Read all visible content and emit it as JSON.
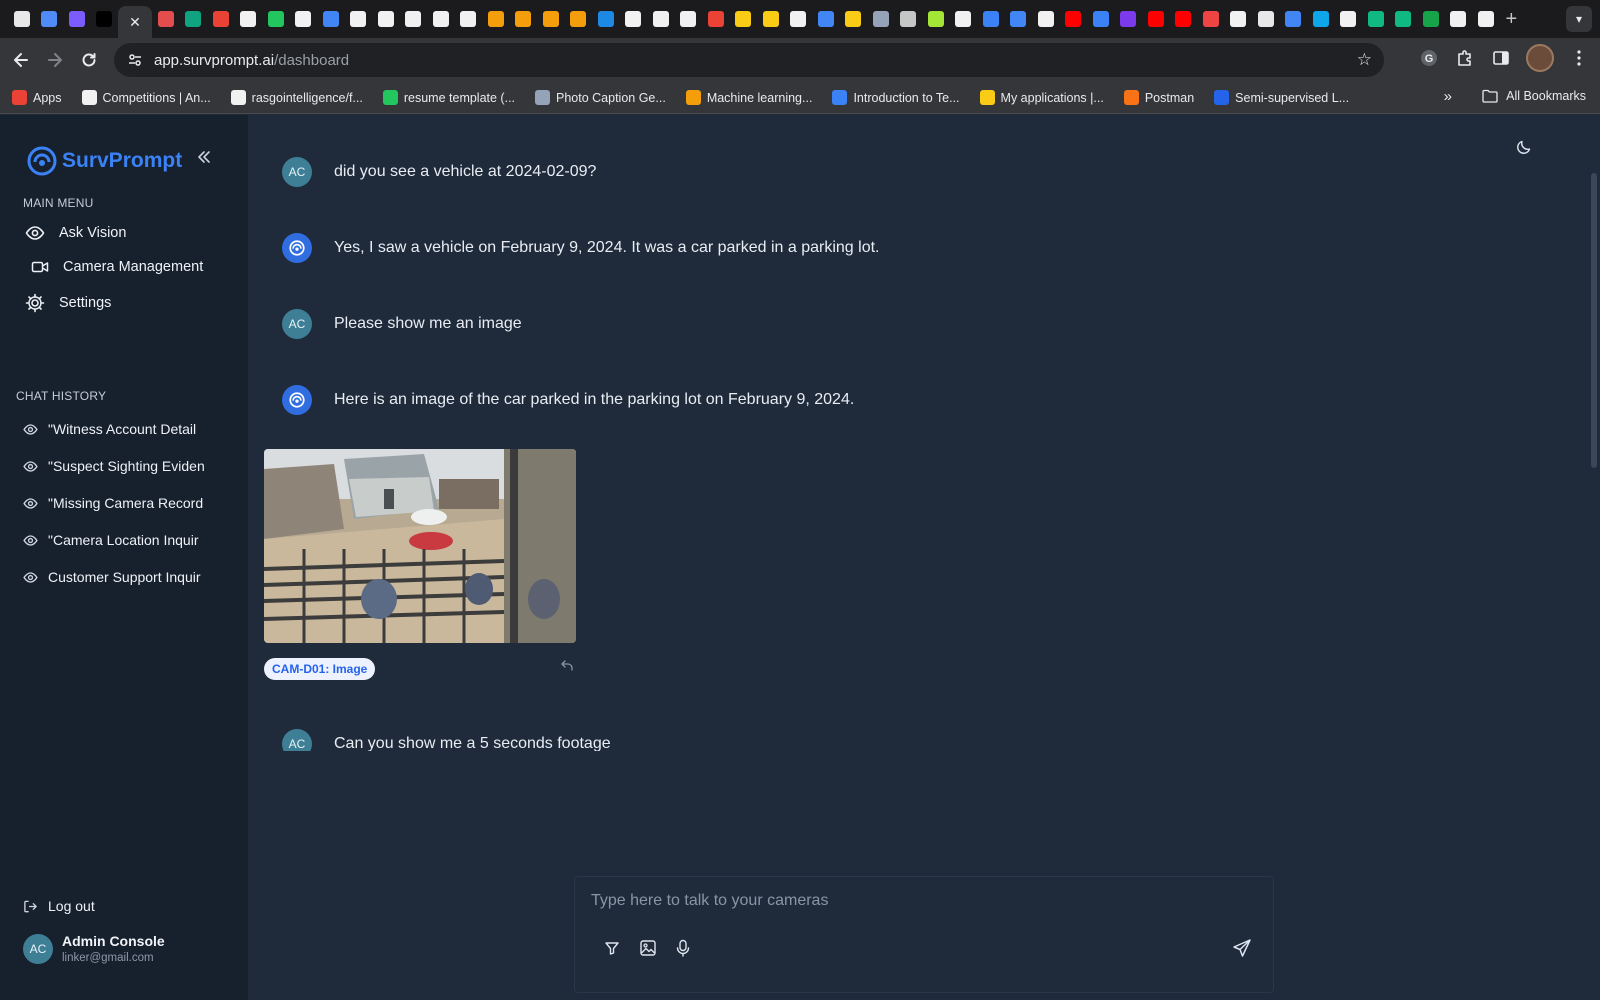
{
  "browser": {
    "active_tab_close": "✕",
    "url_domain": "app.survprompt.ai",
    "url_path": "/dashboard",
    "tab_favicon_colors": [
      "#e8e8e8",
      "#4f8cf7",
      "#7c5cff",
      "#000000",
      "#e34d4d",
      "#10a37f",
      "#ea4335",
      "#f1f1f1",
      "#22c55e",
      "#f1f1f1",
      "#4285f4",
      "#f1f1f1",
      "#f1f1f1",
      "#f1f1f1",
      "#f1f1f1",
      "#f1f1f1",
      "#f59e0b",
      "#f59e0b",
      "#f59e0b",
      "#f59e0b",
      "#1e88e5",
      "#f1f1f1",
      "#f1f1f1",
      "#f1f1f1",
      "#ea4335",
      "#facc15",
      "#facc15",
      "#f1f1f1",
      "#4285f4",
      "#facc15",
      "#94a3b8",
      "#c4c7c5",
      "#a3e635",
      "#f1f1f1",
      "#3b82f6",
      "#4285f4",
      "#f1f1f1",
      "#ff0000",
      "#3b82f6",
      "#7c3aed",
      "#ff0000",
      "#ff0000",
      "#ef4444",
      "#f1f1f1",
      "#e8e8e8",
      "#4285f4",
      "#0ea5e9",
      "#f1f1f1",
      "#10b981",
      "#10b981",
      "#16a34a",
      "#f1f1f1",
      "#f1f1f1"
    ],
    "bookmarks": [
      {
        "label": "Apps",
        "color": "#ea4335"
      },
      {
        "label": "Competitions | An...",
        "color": "#f1f1f1"
      },
      {
        "label": "rasgointelligence/f...",
        "color": "#f1f1f1"
      },
      {
        "label": "resume template (...",
        "color": "#22c55e"
      },
      {
        "label": "Photo Caption Ge...",
        "color": "#94a3b8"
      },
      {
        "label": "Machine learning...",
        "color": "#f59e0b"
      },
      {
        "label": "Introduction to Te...",
        "color": "#3b82f6"
      },
      {
        "label": "My applications |...",
        "color": "#facc15"
      },
      {
        "label": "Postman",
        "color": "#f97316"
      },
      {
        "label": "Semi-supervised L...",
        "color": "#2563eb"
      }
    ],
    "all_bookmarks": "All Bookmarks"
  },
  "sidebar": {
    "brand": "SurvPrompt",
    "main_menu_label": "MAIN MENU",
    "menu": [
      {
        "label": "Ask Vision",
        "icon": "eye-icon"
      },
      {
        "label": "Camera Management",
        "icon": "video-camera-icon"
      },
      {
        "label": "Settings",
        "icon": "gear-icon"
      }
    ],
    "chat_history_label": "CHAT HISTORY",
    "history": [
      "\"Witness Account Detail",
      "\"Suspect Sighting Eviden",
      "\"Missing Camera Record",
      "\"Camera Location Inquir",
      "Customer Support Inquir"
    ],
    "logout": "Log out",
    "user": {
      "initials": "AC",
      "name": "Admin Console",
      "email": "linker@gmail.com"
    }
  },
  "chat": {
    "messages": [
      {
        "role": "user",
        "initials": "AC",
        "text": "did you see a vehicle at 2024-02-09?"
      },
      {
        "role": "assistant",
        "text": "Yes, I saw a vehicle on February 9, 2024. It was a car parked in a parking lot."
      },
      {
        "role": "user",
        "initials": "AC",
        "text": "Please show me an image"
      },
      {
        "role": "assistant",
        "text": "Here is an image of the car parked in the parking lot on February 9, 2024."
      },
      {
        "role": "user",
        "initials": "AC",
        "text": "Can you show me a 5 seconds footage"
      }
    ],
    "image_badge": "CAM-D01: Image"
  },
  "composer": {
    "placeholder": "Type here to talk to your cameras",
    "value": ""
  },
  "colors": {
    "accent": "#3b82f6",
    "sidebar_bg": "#17202d",
    "main_bg": "#1f2a3b"
  }
}
